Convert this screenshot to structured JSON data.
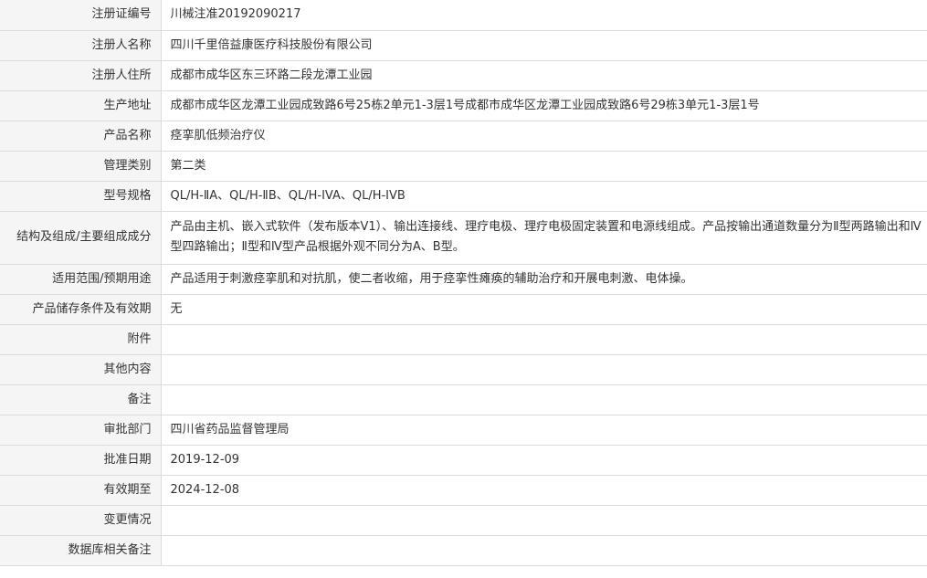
{
  "rows": [
    {
      "label": "注册证编号",
      "value": "川械注准20192090217"
    },
    {
      "label": "注册人名称",
      "value": "四川千里倍益康医疗科技股份有限公司"
    },
    {
      "label": "注册人住所",
      "value": "成都市成华区东三环路二段龙潭工业园"
    },
    {
      "label": "生产地址",
      "value": "成都市成华区龙潭工业园成致路6号25栋2单元1-3层1号成都市成华区龙潭工业园成致路6号29栋3单元1-3层1号"
    },
    {
      "label": "产品名称",
      "value": "痉挛肌低频治疗仪"
    },
    {
      "label": "管理类别",
      "value": "第二类"
    },
    {
      "label": "型号规格",
      "value": "QL/H-ⅡA、QL/H-ⅡB、QL/H-IVA、QL/H-IVB"
    },
    {
      "label": "结构及组成/主要组成成分",
      "value": "产品由主机、嵌入式软件（发布版本V1）、输出连接线、理疗电极、理疗电极固定装置和电源线组成。产品按输出通道数量分为Ⅱ型两路输出和Ⅳ型四路输出；Ⅱ型和Ⅳ型产品根据外观不同分为A、B型。"
    },
    {
      "label": "适用范围/预期用途",
      "value": "产品适用于刺激痉挛肌和对抗肌，使二者收缩，用于痉挛性瘫痪的辅助治疗和开展电刺激、电体操。"
    },
    {
      "label": "产品储存条件及有效期",
      "value": "无"
    },
    {
      "label": "附件",
      "value": ""
    },
    {
      "label": "其他内容",
      "value": ""
    },
    {
      "label": "备注",
      "value": ""
    },
    {
      "label": "审批部门",
      "value": "四川省药品监督管理局"
    },
    {
      "label": "批准日期",
      "value": "2019-12-09"
    },
    {
      "label": "有效期至",
      "value": "2024-12-08"
    },
    {
      "label": "变更情况",
      "value": ""
    },
    {
      "label": "数据库相关备注",
      "value": ""
    }
  ]
}
